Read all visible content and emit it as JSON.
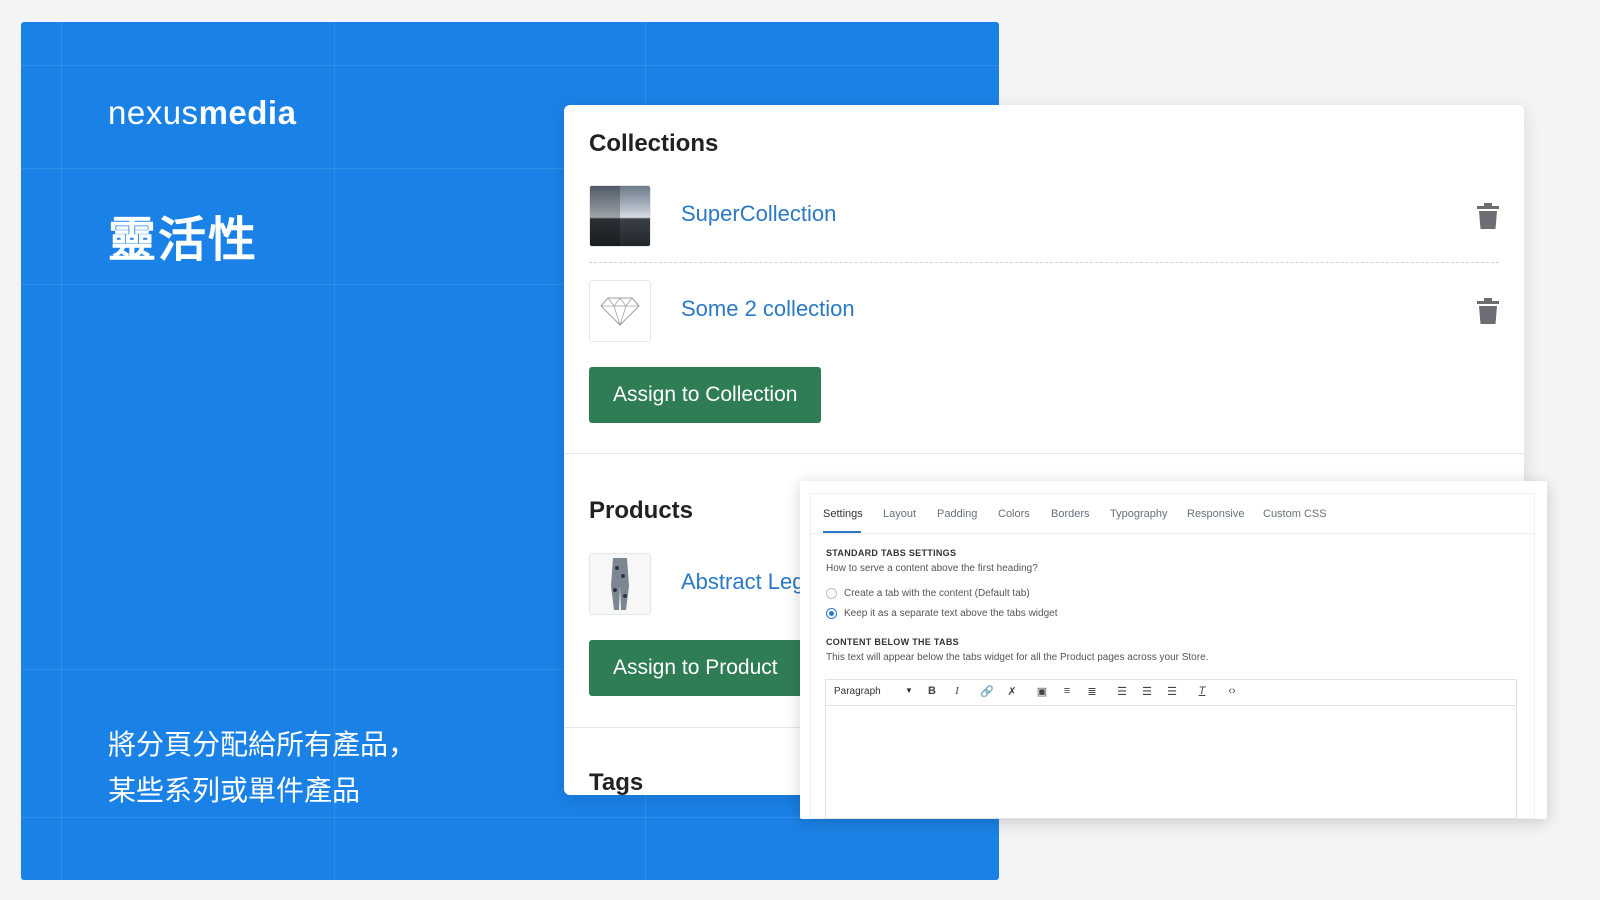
{
  "hero": {
    "logo_light": "nexus",
    "logo_bold": "media",
    "title": "靈活性",
    "desc_line1": "將分頁分配給所有產品，",
    "desc_line2": "某些系列或單件產品",
    "color": "#1a82e6"
  },
  "collections": {
    "title": "Collections",
    "items": [
      {
        "name": "SuperCollection",
        "thumb": "sea-image"
      },
      {
        "name": "Some 2 collection",
        "thumb": "diamond-icon"
      }
    ],
    "assign_label": "Assign to Collection"
  },
  "products": {
    "title": "Products",
    "items": [
      {
        "name": "Abstract Leg",
        "thumb": "leggings-image"
      }
    ],
    "assign_label": "Assign to Product"
  },
  "tags": {
    "title": "Tags"
  },
  "settings_panel": {
    "tabs": [
      "Settings",
      "Layout",
      "Padding",
      "Colors",
      "Borders",
      "Typography",
      "Responsive",
      "Custom CSS"
    ],
    "active_tab": "Settings",
    "standard_heading": "STANDARD TABS SETTINGS",
    "standard_question": "How to serve a content above the first heading?",
    "option1": "Create a tab with the content (Default tab)",
    "option2": "Keep it as a separate text above the tabs widget",
    "selected_option": 2,
    "below_heading": "CONTENT BELOW THE TABS",
    "below_text": "This text will appear below the tabs widget for all the Product pages across your Store.",
    "editor_format": "Paragraph"
  },
  "colors": {
    "link": "#2b78c5",
    "button": "#2f7d54"
  }
}
